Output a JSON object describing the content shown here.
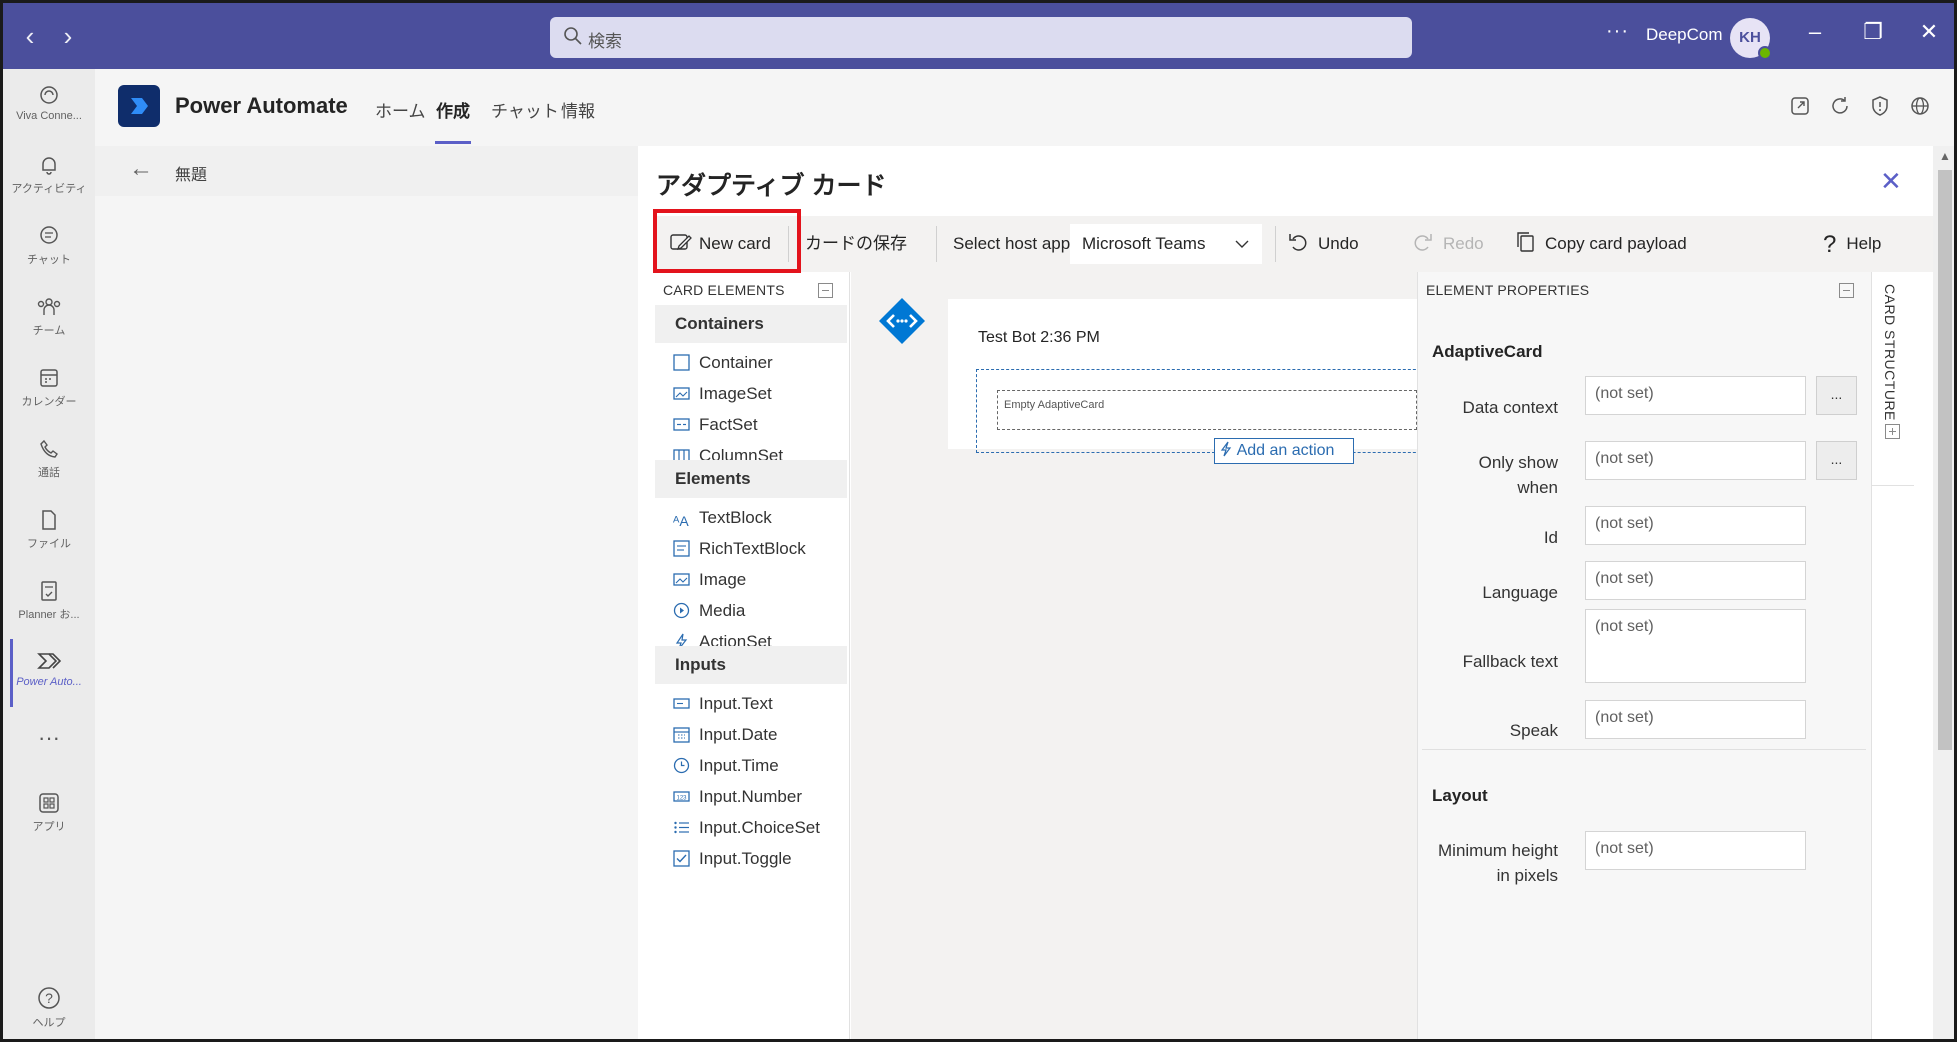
{
  "titlebar": {
    "back_icon": "chevron-left-icon",
    "forward_icon": "chevron-right-icon",
    "search_placeholder": "検索",
    "more": "···",
    "org_name": "DeepCom",
    "avatar_initials": "KH"
  },
  "rail": {
    "items": [
      {
        "label": "Viva Conne...",
        "icon": "viva-connections-icon"
      },
      {
        "label": "アクティビティ",
        "icon": "bell-icon"
      },
      {
        "label": "チャット",
        "icon": "chat-icon"
      },
      {
        "label": "チーム",
        "icon": "teams-icon"
      },
      {
        "label": "カレンダー",
        "icon": "calendar-icon"
      },
      {
        "label": "通話",
        "icon": "phone-icon"
      },
      {
        "label": "ファイル",
        "icon": "file-icon"
      },
      {
        "label": "Planner お...",
        "icon": "planner-icon"
      },
      {
        "label": "Power Auto...",
        "icon": "power-automate-icon"
      }
    ],
    "more": "···",
    "apps_label": "アプリ",
    "help_label": "ヘルプ"
  },
  "app_header": {
    "name": "Power Automate",
    "tabs": [
      "ホーム",
      "作成",
      "チャット",
      "情報"
    ],
    "active_tab": "作成"
  },
  "page": {
    "title": "無題"
  },
  "dialog": {
    "title": "アダプティブ カード",
    "toolbar": {
      "new_card": "New card",
      "save_card": "カードの保存",
      "host_label": "Select host app:",
      "host_value": "Microsoft Teams",
      "undo": "Undo",
      "redo": "Redo",
      "copy_payload": "Copy card payload",
      "help": "Help"
    },
    "card_elements": {
      "header": "CARD ELEMENTS",
      "groups": [
        {
          "name": "Containers",
          "items": [
            "Container",
            "ImageSet",
            "FactSet",
            "ColumnSet"
          ]
        },
        {
          "name": "Elements",
          "items": [
            "TextBlock",
            "RichTextBlock",
            "Image",
            "Media",
            "ActionSet"
          ]
        },
        {
          "name": "Inputs",
          "items": [
            "Input.Text",
            "Input.Date",
            "Input.Time",
            "Input.Number",
            "Input.ChoiceSet",
            "Input.Toggle"
          ]
        }
      ]
    },
    "preview": {
      "sender": "Test Bot 2:36 PM",
      "empty_card": "Empty AdaptiveCard",
      "add_action": "Add an action"
    },
    "properties": {
      "header": "ELEMENT PROPERTIES",
      "section_title": "AdaptiveCard",
      "fields": [
        {
          "label": "Data context",
          "value": "(not set)",
          "has_button": true
        },
        {
          "label": "Only show when",
          "value": "(not set)",
          "has_button": true
        },
        {
          "label": "Id",
          "value": "(not set)"
        },
        {
          "label": "Language",
          "value": "(not set)"
        },
        {
          "label": "Fallback text",
          "value": "(not set)"
        },
        {
          "label": "Speak",
          "value": "(not set)"
        }
      ],
      "layout_title": "Layout",
      "layout_fields": [
        {
          "label": "Minimum height in pixels",
          "value": "(not set)"
        }
      ],
      "dots": "..."
    },
    "card_structure": "CARD STRUCTURE"
  }
}
